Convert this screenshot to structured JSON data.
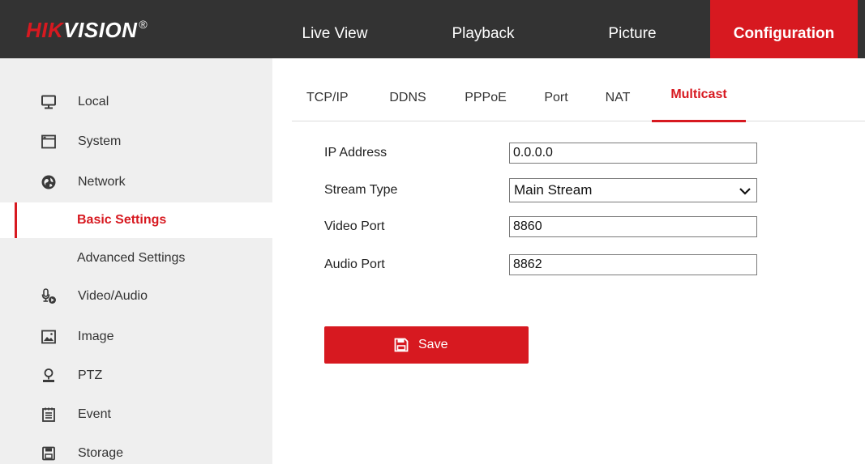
{
  "header": {
    "logo_red": "HIK",
    "logo_white": "VISION",
    "logo_reg": "®",
    "nav": [
      {
        "label": "Live View"
      },
      {
        "label": "Playback"
      },
      {
        "label": "Picture"
      },
      {
        "label": "Configuration",
        "active": true
      }
    ]
  },
  "sidebar": {
    "items": [
      {
        "label": "Local",
        "icon": "monitor-icon"
      },
      {
        "label": "System",
        "icon": "window-icon"
      },
      {
        "label": "Network",
        "icon": "globe-icon"
      },
      {
        "label": "Basic Settings",
        "sub": true,
        "active": true
      },
      {
        "label": "Advanced Settings",
        "sub": true
      },
      {
        "label": "Video/Audio",
        "icon": "microphone-icon"
      },
      {
        "label": "Image",
        "icon": "image-icon"
      },
      {
        "label": "PTZ",
        "icon": "ptz-icon"
      },
      {
        "label": "Event",
        "icon": "event-icon"
      },
      {
        "label": "Storage",
        "icon": "storage-icon"
      }
    ]
  },
  "tabs": [
    {
      "label": "TCP/IP"
    },
    {
      "label": "DDNS"
    },
    {
      "label": "PPPoE"
    },
    {
      "label": "Port"
    },
    {
      "label": "NAT"
    },
    {
      "label": "Multicast",
      "active": true
    }
  ],
  "form": {
    "ip_address": {
      "label": "IP Address",
      "value": "0.0.0.0"
    },
    "stream_type": {
      "label": "Stream Type",
      "value": "Main Stream"
    },
    "video_port": {
      "label": "Video Port",
      "value": "8860"
    },
    "audio_port": {
      "label": "Audio Port",
      "value": "8862"
    }
  },
  "save_button": {
    "label": "Save",
    "icon": "floppy-disk-icon"
  },
  "colors": {
    "accent": "#d71920",
    "header_bg": "#333333",
    "sidebar_bg": "#efefef"
  }
}
